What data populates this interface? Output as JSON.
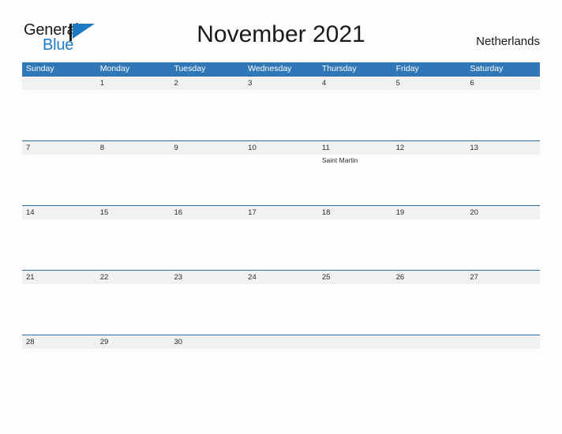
{
  "brand": {
    "name_part1": "General",
    "name_part2": "Blue",
    "flag_icon": "flag-triangle-icon",
    "colors": {
      "dark": "#1a1a1a",
      "blue": "#1f7ac4"
    }
  },
  "header": {
    "title": "November 2021",
    "country": "Netherlands"
  },
  "calendar": {
    "colors": {
      "header_blue": "#3077b8",
      "date_band": "#f1f1f1",
      "rule_blue": "#2e6da4",
      "page_background": "#fdfdfd"
    },
    "weekdays": [
      "Sunday",
      "Monday",
      "Tuesday",
      "Wednesday",
      "Thursday",
      "Friday",
      "Saturday"
    ],
    "weeks": [
      [
        {
          "date": "",
          "events": []
        },
        {
          "date": "1",
          "events": []
        },
        {
          "date": "2",
          "events": []
        },
        {
          "date": "3",
          "events": []
        },
        {
          "date": "4",
          "events": []
        },
        {
          "date": "5",
          "events": []
        },
        {
          "date": "6",
          "events": []
        }
      ],
      [
        {
          "date": "7",
          "events": []
        },
        {
          "date": "8",
          "events": []
        },
        {
          "date": "9",
          "events": []
        },
        {
          "date": "10",
          "events": []
        },
        {
          "date": "11",
          "events": [
            "Saint Martin"
          ]
        },
        {
          "date": "12",
          "events": []
        },
        {
          "date": "13",
          "events": []
        }
      ],
      [
        {
          "date": "14",
          "events": []
        },
        {
          "date": "15",
          "events": []
        },
        {
          "date": "16",
          "events": []
        },
        {
          "date": "17",
          "events": []
        },
        {
          "date": "18",
          "events": []
        },
        {
          "date": "19",
          "events": []
        },
        {
          "date": "20",
          "events": []
        }
      ],
      [
        {
          "date": "21",
          "events": []
        },
        {
          "date": "22",
          "events": []
        },
        {
          "date": "23",
          "events": []
        },
        {
          "date": "24",
          "events": []
        },
        {
          "date": "25",
          "events": []
        },
        {
          "date": "26",
          "events": []
        },
        {
          "date": "27",
          "events": []
        }
      ],
      [
        {
          "date": "28",
          "events": []
        },
        {
          "date": "29",
          "events": []
        },
        {
          "date": "30",
          "events": []
        },
        {
          "date": "",
          "events": []
        },
        {
          "date": "",
          "events": []
        },
        {
          "date": "",
          "events": []
        },
        {
          "date": "",
          "events": []
        }
      ]
    ]
  }
}
